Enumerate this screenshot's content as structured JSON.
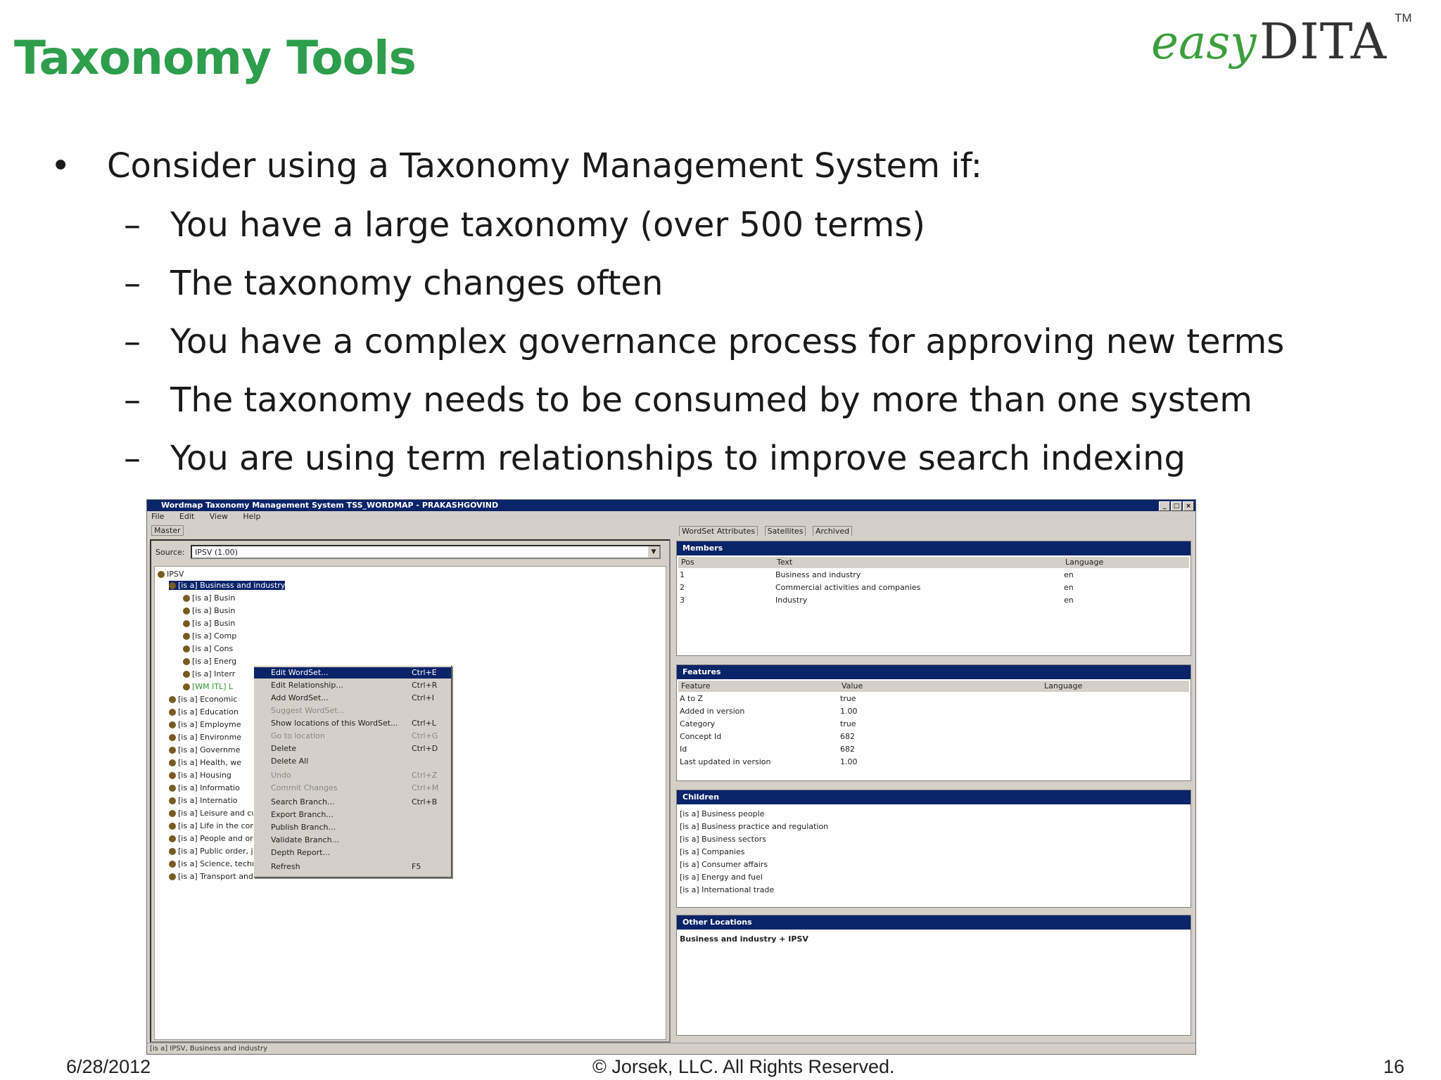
{
  "slide": {
    "title": "Taxonomy Tools",
    "logo": {
      "text_easy": "easy",
      "text_dita": "DITA",
      "tm": "TM"
    },
    "bullet": "Consider using a Taxonomy Management System if:",
    "sub_bullets": [
      "You have a large taxonomy (over 500 terms)",
      "The taxonomy changes often",
      "You have a complex governance process for approving new terms",
      "The taxonomy needs to be consumed by more than one system",
      "You are using term relationships to improve search indexing"
    ],
    "bullet_marker": "•",
    "sub_marker": "–"
  },
  "screenshot": {
    "window_title": "Wordmap Taxonomy Management System TSS_WORDMAP - PRAKASHGOVIND",
    "menu": [
      "File",
      "Edit",
      "View",
      "Help"
    ],
    "master_tab": "Master",
    "source_label": "Source:",
    "source_value": "IPSV (1.00)",
    "tree": {
      "root": "IPSV",
      "selected": "[is a] Business and industry",
      "children": [
        "[is a] Busin",
        "[is a] Busin",
        "[is a] Busin",
        "[is a] Comp",
        "[is a] Cons",
        "[is a] Energ",
        "[is a] Interr",
        "[WM ITL] L"
      ],
      "siblings": [
        "[is a] Economic",
        "[is a] Education",
        "[is a] Employme",
        "[is a] Environme",
        "[is a] Governme",
        "[is a] Health, we",
        "[is a] Housing",
        "[is a] Informatio",
        "[is a] Internatio",
        "[is a] Leisure and culture",
        "[is a] Life in the community",
        "[is a] People and organisations",
        "[is a] Public order, justice and rights",
        "[is a] Science, technology and innovation",
        "[is a] Transport and infrastructure"
      ]
    },
    "context_menu": [
      {
        "label": "Edit WordSet...",
        "shortcut": "Ctrl+E",
        "state": "highlight"
      },
      {
        "label": "Edit Relationship...",
        "shortcut": "Ctrl+R",
        "state": "normal"
      },
      {
        "label": "Add WordSet...",
        "shortcut": "Ctrl+I",
        "state": "normal"
      },
      {
        "label": "Suggest WordSet...",
        "shortcut": "",
        "state": "disabled"
      },
      {
        "label": "Show locations of this WordSet...",
        "shortcut": "Ctrl+L",
        "state": "normal"
      },
      {
        "label": "Go to location",
        "shortcut": "Ctrl+G",
        "state": "disabled"
      },
      {
        "label": "Delete",
        "shortcut": "Ctrl+D",
        "state": "normal"
      },
      {
        "label": "Delete All",
        "shortcut": "",
        "state": "normal"
      },
      {
        "label": "Undo",
        "shortcut": "Ctrl+Z",
        "state": "disabled"
      },
      {
        "label": "Commit Changes",
        "shortcut": "Ctrl+M",
        "state": "disabled"
      },
      {
        "label": "Search Branch...",
        "shortcut": "Ctrl+B",
        "state": "normal"
      },
      {
        "label": "Export Branch...",
        "shortcut": "",
        "state": "normal"
      },
      {
        "label": "Publish Branch...",
        "shortcut": "",
        "state": "normal"
      },
      {
        "label": "Validate Branch...",
        "shortcut": "",
        "state": "normal"
      },
      {
        "label": "Depth Report...",
        "shortcut": "",
        "state": "normal"
      },
      {
        "label": "Refresh",
        "shortcut": "F5",
        "state": "normal"
      }
    ],
    "right_tabs": [
      "WordSet Attributes",
      "Satellites",
      "Archived"
    ],
    "members": {
      "header": "Members",
      "columns": [
        "Pos",
        "Text",
        "Language"
      ],
      "rows": [
        [
          "1",
          "Business and industry",
          "en"
        ],
        [
          "2",
          "Commercial activities and companies",
          "en"
        ],
        [
          "3",
          "Industry",
          "en"
        ]
      ]
    },
    "features": {
      "header": "Features",
      "columns": [
        "Feature",
        "Value",
        "Language"
      ],
      "rows": [
        [
          "A to Z",
          "true"
        ],
        [
          "Added in version",
          "1.00"
        ],
        [
          "Category",
          "true"
        ],
        [
          "Concept Id",
          "682"
        ],
        [
          "Id",
          "682"
        ],
        [
          "Last updated in version",
          "1.00"
        ]
      ]
    },
    "children_panel": {
      "header": "Children",
      "items": [
        "[is a] Business people",
        "[is a] Business practice and regulation",
        "[is a] Business sectors",
        "[is a] Companies",
        "[is a] Consumer affairs",
        "[is a] Energy and fuel",
        "[is a] International trade"
      ]
    },
    "other_locations": {
      "header": "Other Locations",
      "value": "Business and industry + IPSV"
    },
    "status": "[is a] IPSV, Business and industry"
  },
  "footer": {
    "date": "6/28/2012",
    "copyright": "© Jorsek, LLC. All Rights Reserved.",
    "page": "16"
  }
}
